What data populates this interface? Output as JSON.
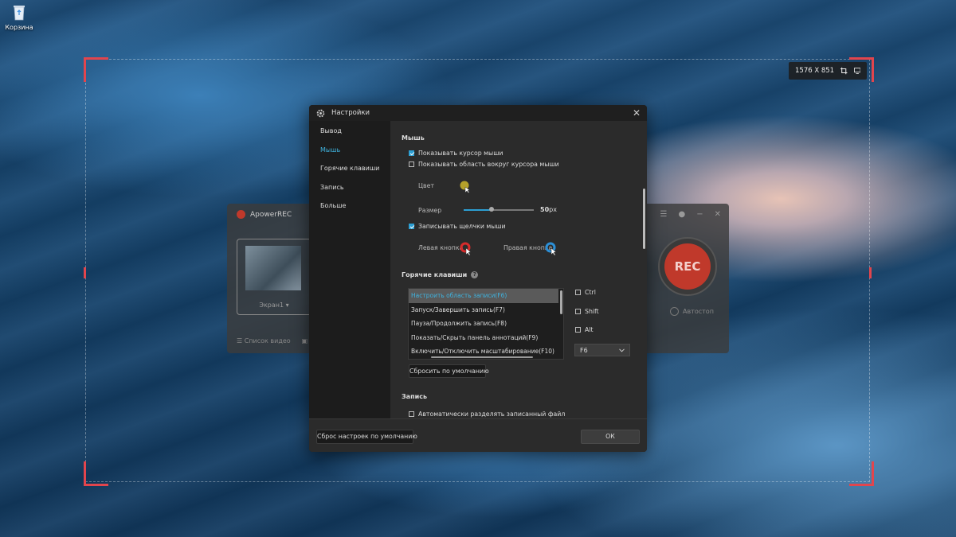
{
  "desktop": {
    "recycle_bin_label": "Корзина"
  },
  "capture": {
    "size_text": "1576 X 851",
    "accent_color": "#e2454d"
  },
  "recorder": {
    "title": "ApowerREC",
    "screen_label": "Экран1",
    "screen_caret": "▾",
    "video_list_label": "Список видео",
    "rec_label": "REC",
    "autostop_label": "Автостоп"
  },
  "dialog": {
    "title": "Настройки",
    "nav": [
      "Вывод",
      "Мышь",
      "Горячие клавиши",
      "Запись",
      "Больше"
    ],
    "active_nav_index": 1,
    "mouse": {
      "heading": "Мышь",
      "show_cursor": "Показывать курсор мыши",
      "show_cursor_checked": true,
      "show_area": "Показывать область вокруг курсора мыши",
      "show_area_checked": false,
      "color_label": "Цвет",
      "color_value": "#b5a12a",
      "size_label": "Размер",
      "size_value": "50",
      "size_unit": "px",
      "size_level": 0.4,
      "record_clicks": "Записывать щелчки мыши",
      "record_clicks_checked": true,
      "left_button": "Левая кнопка",
      "left_button_color": "#d62b2b",
      "right_button": "Правая кнопка",
      "right_button_color": "#2c8fd6"
    },
    "hotkeys": {
      "heading": "Горячие клавиши",
      "help": "?",
      "items": [
        "Настроить область записи(F6)",
        "Запуск/Завершить запись(F7)",
        "Пауза/Продолжить запись(F8)",
        "Показать/Скрыть панель аннотаций(F9)",
        "Включить/Отключить масштабирование(F10)"
      ],
      "selected_index": 0,
      "ctrl": "Ctrl",
      "shift": "Shift",
      "alt": "Alt",
      "key_value": "F6",
      "reset_label": "Сбросить по умолчанию"
    },
    "record": {
      "heading": "Запись",
      "auto_split": "Автоматически разделять записанный файл",
      "auto_split_checked": false
    },
    "footer": {
      "reset_all_label": "Сброс настроек по умолчанию",
      "ok_label": "ОК"
    }
  }
}
